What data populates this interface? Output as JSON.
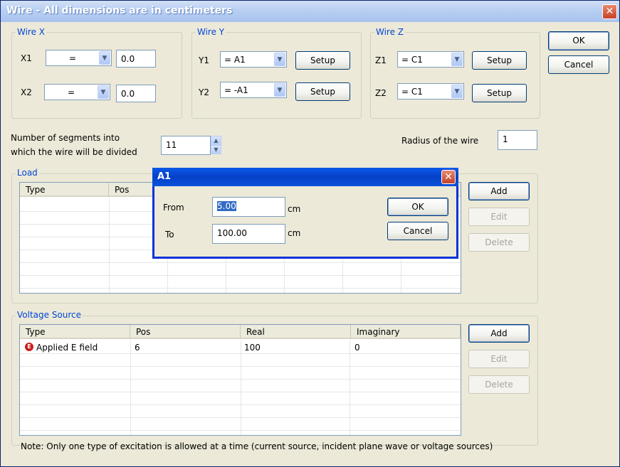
{
  "window": {
    "title": "Wire - All dimensions are in centimeters",
    "close": "✕"
  },
  "wire_x": {
    "label": "Wire X",
    "rows": [
      {
        "name": "X1",
        "op": "=",
        "value": "0.0"
      },
      {
        "name": "X2",
        "op": "=",
        "value": "0.0"
      }
    ]
  },
  "wire_y": {
    "label": "Wire Y",
    "rows": [
      {
        "name": "Y1",
        "value": "= A1",
        "setup": "Setup"
      },
      {
        "name": "Y2",
        "value": "= -A1",
        "setup": "Setup"
      }
    ]
  },
  "wire_z": {
    "label": "Wire Z",
    "rows": [
      {
        "name": "Z1",
        "value": "= C1",
        "setup": "Setup"
      },
      {
        "name": "Z2",
        "value": "= C1",
        "setup": "Setup"
      }
    ]
  },
  "buttons": {
    "ok": "OK",
    "cancel": "Cancel"
  },
  "segments": {
    "label_line1": "Number of segments into",
    "label_line2": "which the wire will be divided",
    "value": "11"
  },
  "radius": {
    "label": "Radius of the wire",
    "value": "1"
  },
  "load": {
    "label": "Load",
    "columns": [
      "Type",
      "Pos"
    ],
    "add": "Add",
    "edit": "Edit",
    "delete": "Delete"
  },
  "voltage_source": {
    "label": "Voltage Source",
    "columns": [
      "Type",
      "Pos",
      "Real",
      "Imaginary"
    ],
    "rows": [
      {
        "icon": "E",
        "type": "Applied E field",
        "pos": "6",
        "real": "100",
        "imag": "0"
      }
    ],
    "add": "Add",
    "edit": "Edit",
    "delete": "Delete"
  },
  "note": "Note: Only one type of excitation is allowed at a time (current source, incident plane wave or voltage sources)",
  "popup": {
    "title": "A1",
    "close": "✕",
    "from_label": "From",
    "from_value": "5.00",
    "from_unit": "cm",
    "to_label": "To",
    "to_value": "100.00",
    "to_unit": "cm",
    "ok": "OK",
    "cancel": "Cancel"
  },
  "icons": {
    "dropdown": "chevron-down-icon",
    "spin": "spin-arrows-icon",
    "source": "e-field-icon"
  }
}
